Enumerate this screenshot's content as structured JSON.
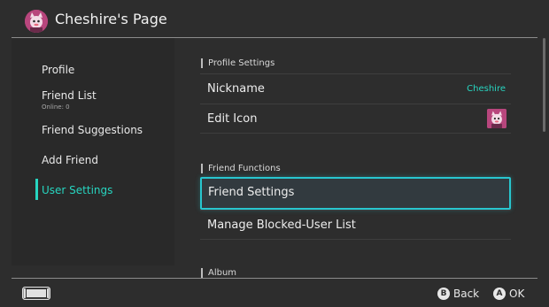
{
  "header": {
    "title": "Cheshire's Page",
    "avatar_icon": "cat-avatar-icon"
  },
  "sidebar": {
    "items": [
      {
        "label": "Profile"
      },
      {
        "label": "Friend List",
        "sub": "Online: 0"
      },
      {
        "label": "Friend Suggestions"
      },
      {
        "label": "Add Friend"
      },
      {
        "label": "User Settings",
        "active": true
      }
    ],
    "accent_color": "#27d5c0"
  },
  "sections": {
    "profile": {
      "title": "Profile Settings",
      "rows": [
        {
          "label": "Nickname",
          "value": "Cheshire"
        },
        {
          "label": "Edit Icon",
          "icon": "cat-avatar-icon"
        }
      ]
    },
    "friend_functions": {
      "title": "Friend Functions",
      "rows": [
        {
          "label": "Friend Settings",
          "selected": true
        },
        {
          "label": "Manage Blocked-User List"
        }
      ]
    },
    "album": {
      "title": "Album"
    }
  },
  "footer": {
    "controller_icon": "handheld-console-icon",
    "back": {
      "button": "B",
      "label": "Back"
    },
    "ok": {
      "button": "A",
      "label": "OK"
    }
  },
  "colors": {
    "background": "#2d2d2d",
    "sidebar": "#292929",
    "selection_border": "#28c6cf"
  }
}
